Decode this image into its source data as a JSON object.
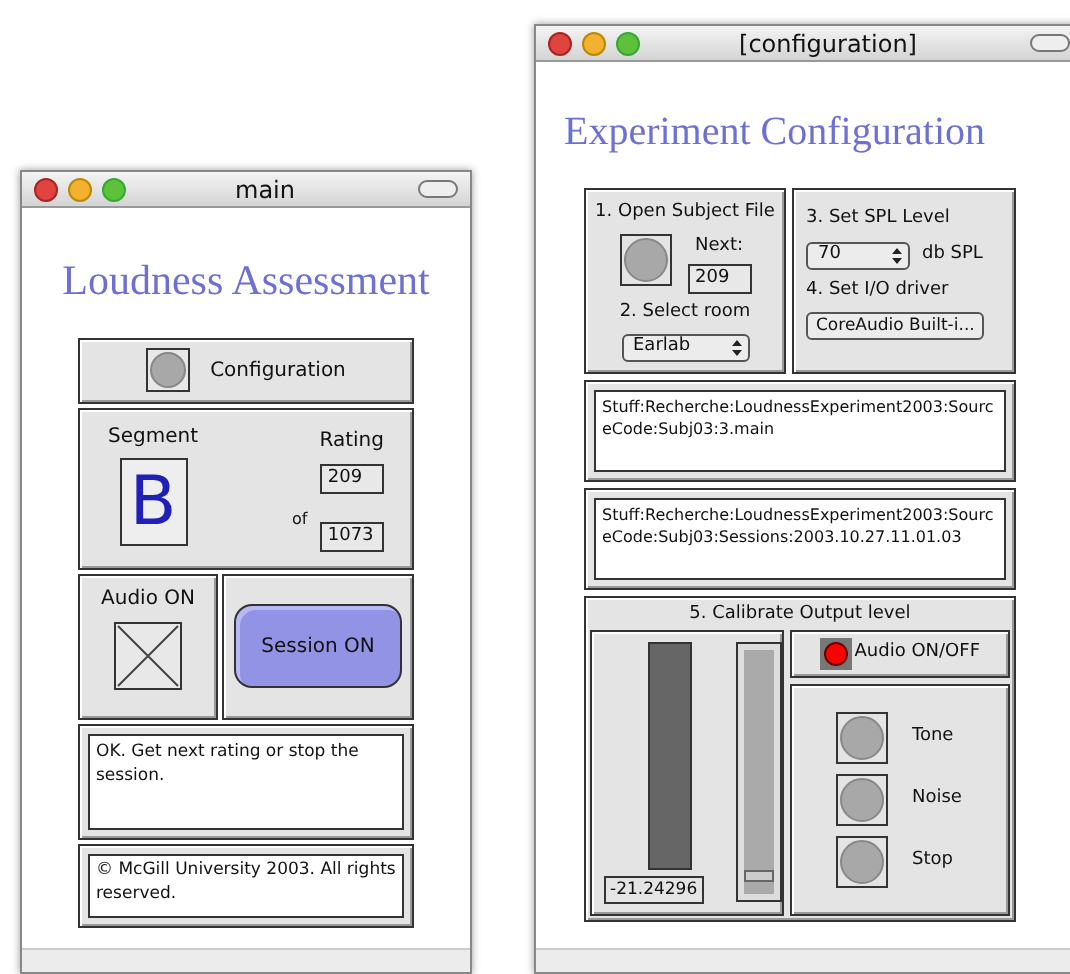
{
  "main_window": {
    "title": "main",
    "heading": "Loudness Assessment",
    "configuration_button": "Configuration",
    "segment_label": "Segment",
    "segment_value": "B",
    "rating_label": "Rating",
    "rating_current": "209",
    "of_label": "of",
    "rating_total": "1073",
    "audio_label": "Audio ON",
    "audio_checked": true,
    "session_button": "Session ON",
    "message": "OK. Get next rating or stop the session.",
    "copyright": "© McGill University 2003. All rights reserved."
  },
  "config_window": {
    "title": "[configuration]",
    "heading": "Experiment Configuration",
    "step1": "1. Open Subject File",
    "next_label": "Next:",
    "next_value": "209",
    "step2": "2. Select room",
    "room": "Earlab",
    "step3": "3. Set SPL Level",
    "spl": "70",
    "spl_unit": "db SPL",
    "step4": "4. Set I/O driver",
    "driver": "CoreAudio Built-i...",
    "paths": [
      "Stuff:Recherche:LoudnessExperiment2003:SourceCode:Subj03:3.main",
      "Stuff:Recherche:LoudnessExperiment2003:SourceCode:Subj03:Sessions:2003.10.27.11.01.03"
    ],
    "calibrate_title": "5. Calibrate Output level",
    "meter_reading": "-21.24296",
    "slider": {
      "level": 0.05
    },
    "audio_toggle": {
      "label": "Audio ON/OFF",
      "on": true
    },
    "buttons": [
      "Tone",
      "Noise",
      "Stop"
    ]
  }
}
